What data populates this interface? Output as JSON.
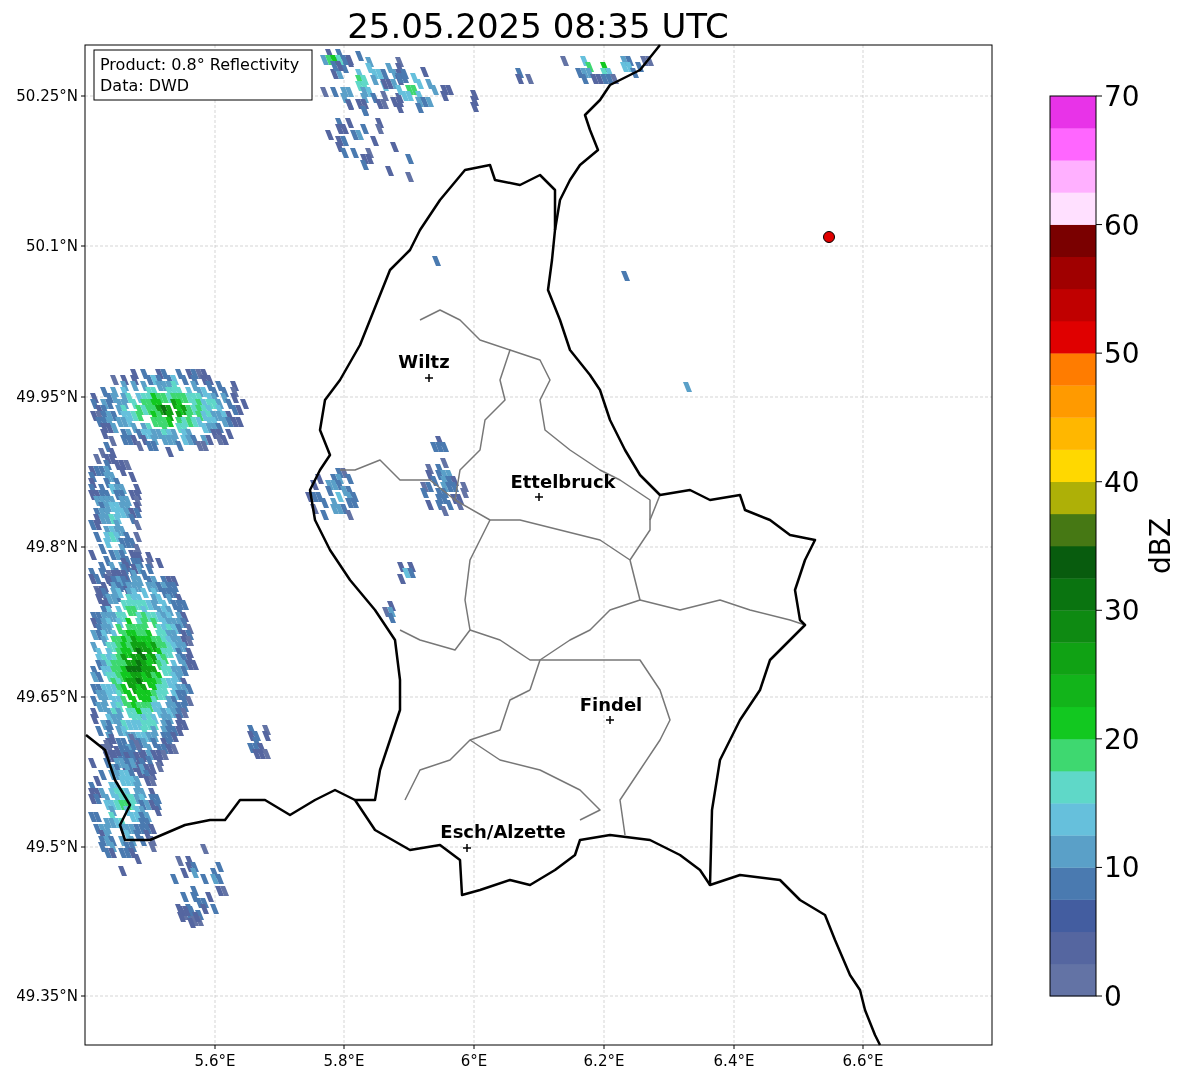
{
  "title": "25.05.2025 08:35 UTC",
  "info_box": [
    "Product: 0.8° Reflectivity",
    "Data: DWD"
  ],
  "map": {
    "x_ticks": [
      "5.6°E",
      "5.8°E",
      "6°E",
      "6.2°E",
      "6.4°E",
      "6.6°E"
    ],
    "y_ticks": [
      "50.25°N",
      "50.1°N",
      "49.95°N",
      "49.8°N",
      "49.65°N",
      "49.5°N",
      "49.35°N"
    ],
    "cities": [
      "Wiltz",
      "Ettelbruck",
      "Findel",
      "Esch/Alzette"
    ]
  },
  "colorbar": {
    "label": "dBZ",
    "ticks": [
      "70",
      "60",
      "50",
      "40",
      "30",
      "20",
      "10",
      "0"
    ],
    "bands": [
      {
        "color": "#6373a5"
      },
      {
        "color": "#5566a0"
      },
      {
        "color": "#435da0"
      },
      {
        "color": "#4a7ab0"
      },
      {
        "color": "#5aa0c8"
      },
      {
        "color": "#66c0dc"
      },
      {
        "color": "#5fd8c8"
      },
      {
        "color": "#3ed870"
      },
      {
        "color": "#12c820"
      },
      {
        "color": "#12b41a"
      },
      {
        "color": "#10a214"
      },
      {
        "color": "#0e8a12"
      },
      {
        "color": "#0a7410"
      },
      {
        "color": "#085c0e"
      },
      {
        "color": "#467814"
      },
      {
        "color": "#aeb007"
      },
      {
        "color": "#ffd800"
      },
      {
        "color": "#ffb700"
      },
      {
        "color": "#ff9a00"
      },
      {
        "color": "#ff7c00"
      },
      {
        "color": "#e00000"
      },
      {
        "color": "#c00000"
      },
      {
        "color": "#a00000"
      },
      {
        "color": "#7a0000"
      },
      {
        "color": "#ffe0ff"
      },
      {
        "color": "#ffb0ff"
      },
      {
        "color": "#ff66ff"
      },
      {
        "color": "#e833e8"
      }
    ]
  }
}
